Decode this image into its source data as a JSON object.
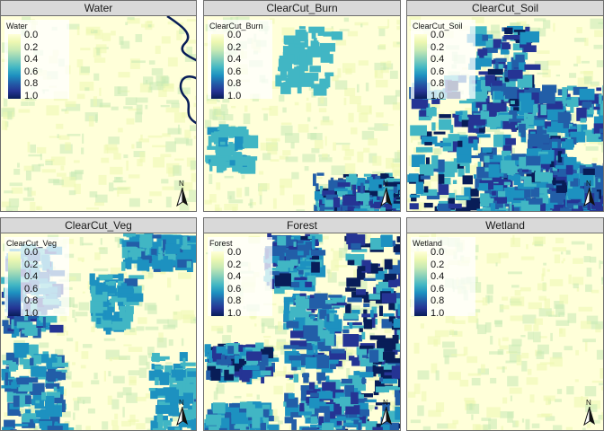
{
  "panels": [
    {
      "title": "Water",
      "legend_title": "Water",
      "ticks": [
        "0.0",
        "0.2",
        "0.4",
        "0.6",
        "0.8",
        "1.0"
      ],
      "coverage": 0.02,
      "blobs": "water"
    },
    {
      "title": "ClearCut_Burn",
      "legend_title": "ClearCut_Burn",
      "ticks": [
        "0.0",
        "0.2",
        "0.4",
        "0.6",
        "0.8",
        "1.0"
      ],
      "coverage": 0.18,
      "blobs": "burn"
    },
    {
      "title": "ClearCut_Soil",
      "legend_title": "ClearCut_Soil",
      "ticks": [
        "0.0",
        "0.2",
        "0.4",
        "0.6",
        "0.8",
        "1.0"
      ],
      "coverage": 0.6,
      "blobs": "soil"
    },
    {
      "title": "ClearCut_Veg",
      "legend_title": "ClearCut_Veg",
      "ticks": [
        "0.0",
        "0.2",
        "0.4",
        "0.6",
        "0.8",
        "1.0"
      ],
      "coverage": 0.22,
      "blobs": "veg"
    },
    {
      "title": "Forest",
      "legend_title": "Forest",
      "ticks": [
        "0.0",
        "0.2",
        "0.4",
        "0.6",
        "0.8",
        "1.0"
      ],
      "coverage": 0.4,
      "blobs": "forest"
    },
    {
      "title": "Wetland",
      "legend_title": "Wetland",
      "ticks": [
        "0.0",
        "0.2",
        "0.4",
        "0.6",
        "0.8",
        "1.0"
      ],
      "coverage": 0.01,
      "blobs": "wetland"
    }
  ],
  "north_label": "N",
  "palette": {
    "low": "#ffffd9",
    "mid": "#41b6c4",
    "high": "#081d58"
  }
}
